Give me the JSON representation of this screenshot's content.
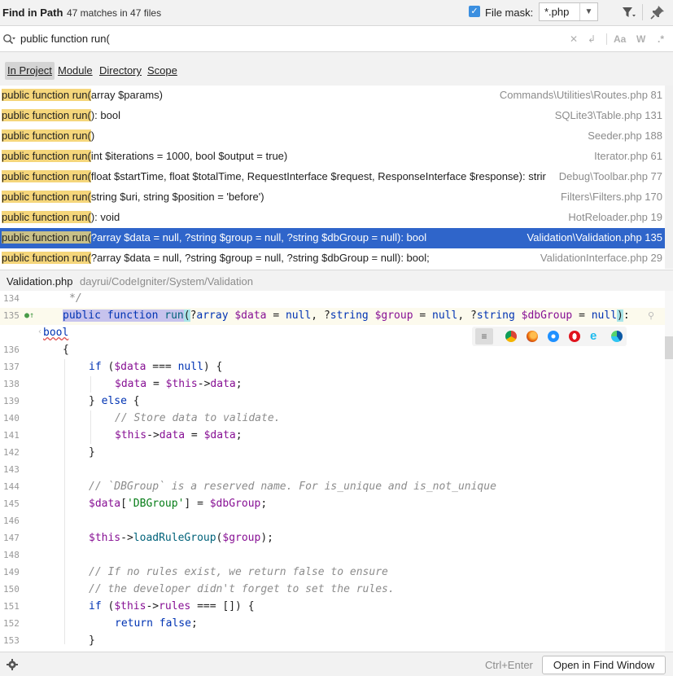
{
  "header": {
    "title": "Find in Path",
    "match_count": "47 matches in 47 files",
    "file_mask_label": "File mask:",
    "file_mask_checked": true,
    "file_mask_value": "*.php"
  },
  "search": {
    "query": "public function run(",
    "tool_icons": [
      "clear-icon",
      "replace-icon",
      "match-case-icon",
      "whole-word-icon",
      "regex-icon"
    ],
    "tool_labels": [
      "Aa",
      "W",
      ".*"
    ]
  },
  "scope_tabs": [
    {
      "label": "In Project",
      "active": true
    },
    {
      "label": "Module",
      "active": false
    },
    {
      "label": "Directory",
      "active": false
    },
    {
      "label": "Scope",
      "active": false
    }
  ],
  "results": [
    {
      "match": "public function run(",
      "rest": "array $params)",
      "file": "Commands\\Utilities\\Routes.php 81"
    },
    {
      "match": "public function run(",
      "rest": "): bool",
      "file": "SQLite3\\Table.php 131"
    },
    {
      "match": "public function run(",
      "rest": ")",
      "file": "Seeder.php 188"
    },
    {
      "match": "public function run(",
      "rest": "int $iterations = 1000, bool $output = true)",
      "file": "Iterator.php 61"
    },
    {
      "match": "public function run(",
      "rest": "float $startTime, float $totalTime, RequestInterface $request, ResponseInterface $response): strir",
      "file": "Debug\\Toolbar.php 77"
    },
    {
      "match": "public function run(",
      "rest": "string $uri, string $position = 'before')",
      "file": "Filters\\Filters.php 170"
    },
    {
      "match": "public function run(",
      "rest": "): void",
      "file": "HotReloader.php 19"
    },
    {
      "match": "public function run(",
      "rest": "?array $data = null, ?string $group = null, ?string $dbGroup = null): bool",
      "file": "Validation\\Validation.php 135",
      "selected": true
    },
    {
      "match": "public function run(",
      "rest": "?array $data = null, ?string $group = null, ?string $dbGroup = null): bool;",
      "file": "ValidationInterface.php 29"
    }
  ],
  "preview": {
    "file_name": "Validation.php",
    "file_path": "dayrui/CodeIgniter/System/Validation"
  },
  "editor": {
    "lines": [
      {
        "num": "134",
        "text": "*/"
      },
      {
        "num": "135",
        "text": "public function run(?array $data = null, ?string $group = null, ?string $dbGroup = null):"
      },
      {
        "num": "",
        "text": "bool"
      },
      {
        "num": "136",
        "text": "{"
      },
      {
        "num": "137",
        "text": "if ($data === null) {"
      },
      {
        "num": "138",
        "text": "$data = $this->data;"
      },
      {
        "num": "139",
        "text": "} else {"
      },
      {
        "num": "140",
        "text": "// Store data to validate."
      },
      {
        "num": "141",
        "text": "$this->data = $data;"
      },
      {
        "num": "142",
        "text": "}"
      },
      {
        "num": "143",
        "text": ""
      },
      {
        "num": "144",
        "text": "// `DBGroup` is a reserved name. For is_unique and is_not_unique"
      },
      {
        "num": "145",
        "text": "$data['DBGroup'] = $dbGroup;"
      },
      {
        "num": "146",
        "text": ""
      },
      {
        "num": "147",
        "text": "$this->loadRuleGroup($group);"
      },
      {
        "num": "148",
        "text": ""
      },
      {
        "num": "149",
        "text": "// If no rules exist, we return false to ensure"
      },
      {
        "num": "150",
        "text": "// the developer didn't forget to set the rules."
      },
      {
        "num": "151",
        "text": "if ($this->rules === []) {"
      },
      {
        "num": "152",
        "text": "return false;"
      },
      {
        "num": "153",
        "text": "}"
      }
    ],
    "browser_icons": [
      "wrap-icon",
      "chrome-icon",
      "firefox-icon",
      "safari-icon",
      "opera-icon",
      "ie-icon",
      "edge-icon"
    ]
  },
  "footer": {
    "shortcut": "Ctrl+Enter",
    "open_button": "Open in Find Window"
  },
  "colors": {
    "selection": "#2f65ca",
    "match_highlight": "#f5d67b",
    "keyword": "#0033b3",
    "variable": "#871094",
    "comment": "#8c8c8c",
    "string": "#067d17"
  }
}
